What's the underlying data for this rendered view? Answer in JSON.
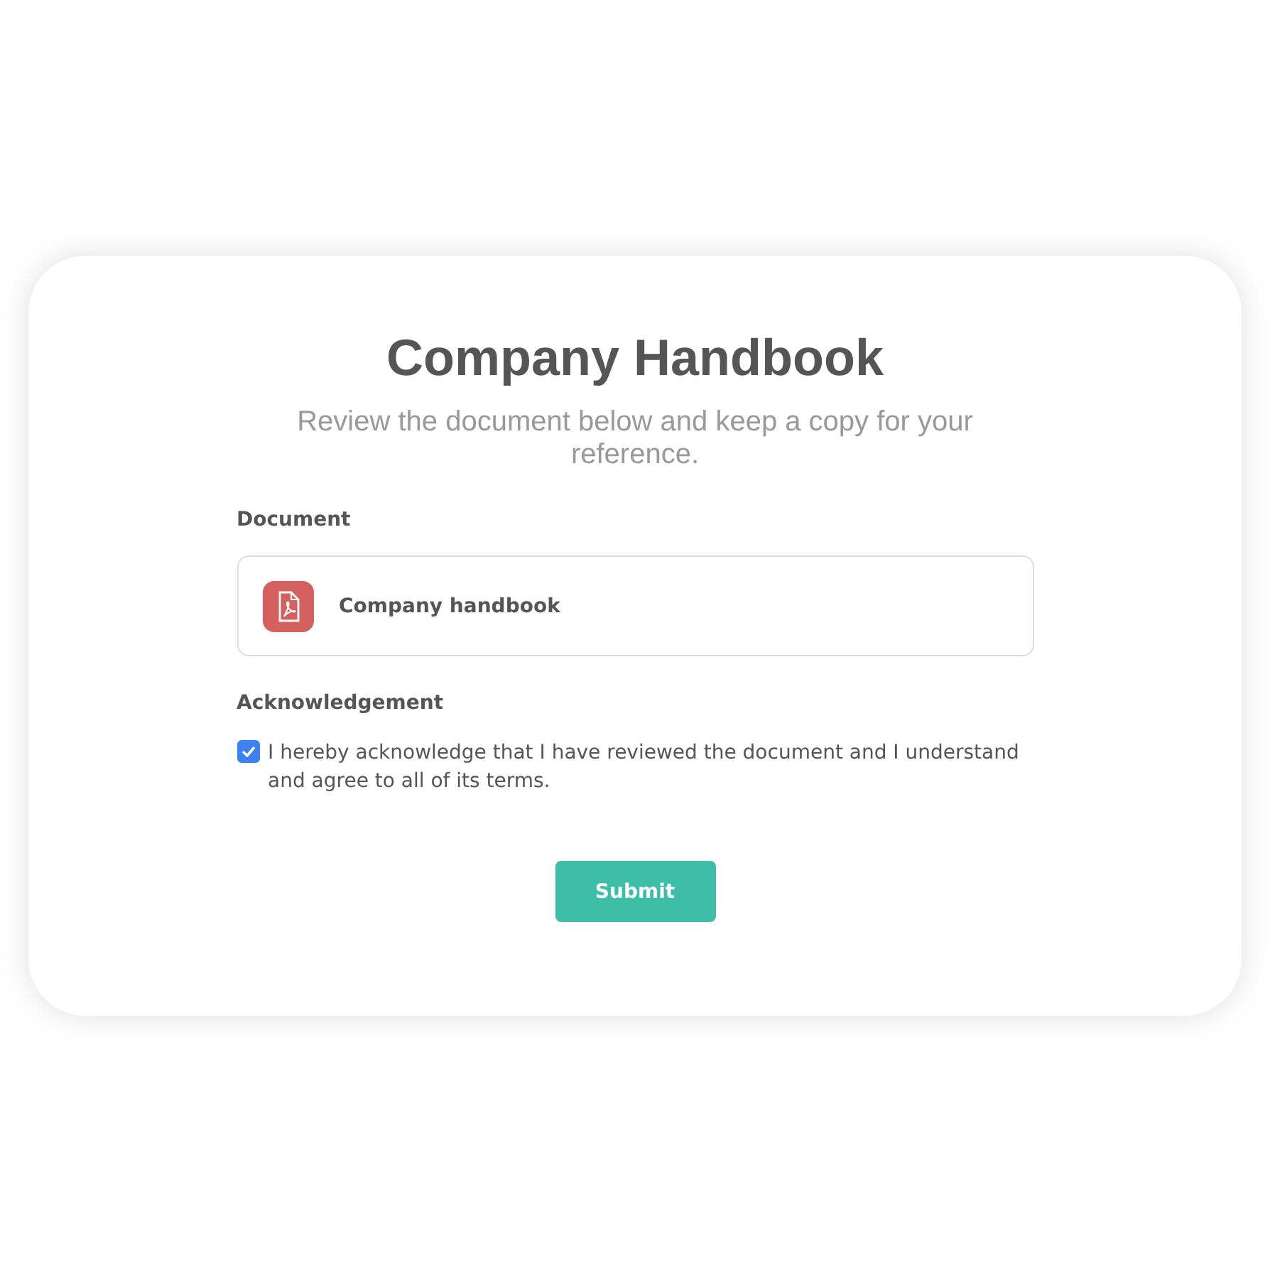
{
  "title": "Company Handbook",
  "subtitle": "Review the document below and keep a copy for your reference.",
  "document": {
    "label": "Document",
    "file": {
      "name": "Company handbook"
    }
  },
  "acknowledgement": {
    "label": "Acknowledgement",
    "checked": true,
    "text": "I hereby acknowledge that I have reviewed the document and I understand and agree to all of its terms."
  },
  "submit": "Submit"
}
